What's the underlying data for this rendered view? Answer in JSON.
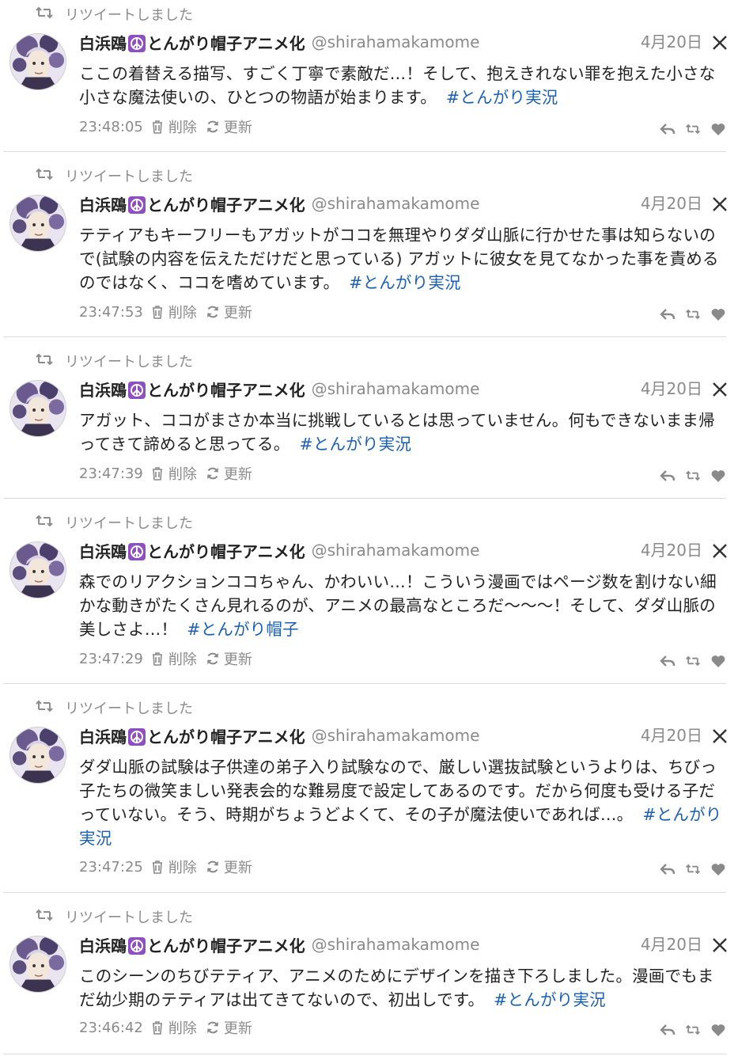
{
  "retweet_label": "リツイートしました",
  "delete_label": "削除",
  "refresh_label": "更新",
  "tweets": [
    {
      "name_prefix": "白浜鴎",
      "name_suffix": "とんがり帽子アニメ化",
      "handle": "@shirahamakamome",
      "date": "4月20日",
      "text": "ここの着替える描写、すごく丁寧で素敵だ…！そして、抱えきれない罪を抱えた小さな小さな魔法使いの、ひとつの物語が始まります。",
      "hashtag": "#とんがり実況",
      "time": "23:48:05"
    },
    {
      "name_prefix": "白浜鴎",
      "name_suffix": "とんがり帽子アニメ化",
      "handle": "@shirahamakamome",
      "date": "4月20日",
      "text": "テティアもキーフリーもアガットがココを無理やりダダ山脈に行かせた事は知らないので(試験の内容を伝えただけだと思っている) アガットに彼女を見てなかった事を責めるのではなく、ココを嗜めています。",
      "hashtag": "#とんがり実況",
      "time": "23:47:53"
    },
    {
      "name_prefix": "白浜鴎",
      "name_suffix": "とんがり帽子アニメ化",
      "handle": "@shirahamakamome",
      "date": "4月20日",
      "text": "アガット、ココがまさか本当に挑戦しているとは思っていません。何もできないまま帰ってきて諦めると思ってる。",
      "hashtag": "#とんがり実況",
      "time": "23:47:39"
    },
    {
      "name_prefix": "白浜鴎",
      "name_suffix": "とんがり帽子アニメ化",
      "handle": "@shirahamakamome",
      "date": "4月20日",
      "text": "森でのリアクションココちゃん、かわいい…！こういう漫画ではページ数を割けない細かな動きがたくさん見れるのが、アニメの最高なところだ〜〜〜！そして、ダダ山脈の美しさよ…！",
      "hashtag": "#とんがり帽子",
      "time": "23:47:29"
    },
    {
      "name_prefix": "白浜鴎",
      "name_suffix": "とんがり帽子アニメ化",
      "handle": "@shirahamakamome",
      "date": "4月20日",
      "text": "ダダ山脈の試験は子供達の弟子入り試験なので、厳しい選抜試験というよりは、ちびっ子たちの微笑ましい発表会的な難易度で設定してあるのです。だから何度も受ける子だっていない。そう、時期がちょうどよくて、その子が魔法使いであれば…。",
      "hashtag": "#とんがり実況",
      "time": "23:47:25"
    },
    {
      "name_prefix": "白浜鴎",
      "name_suffix": "とんがり帽子アニメ化",
      "handle": "@shirahamakamome",
      "date": "4月20日",
      "text": "このシーンのちびテティア、アニメのためにデザインを描き下ろしました。漫画でもまだ幼少期のテティアは出てきてないので、初出しです。",
      "hashtag": "#とんがり実況",
      "time": "23:46:42"
    }
  ]
}
